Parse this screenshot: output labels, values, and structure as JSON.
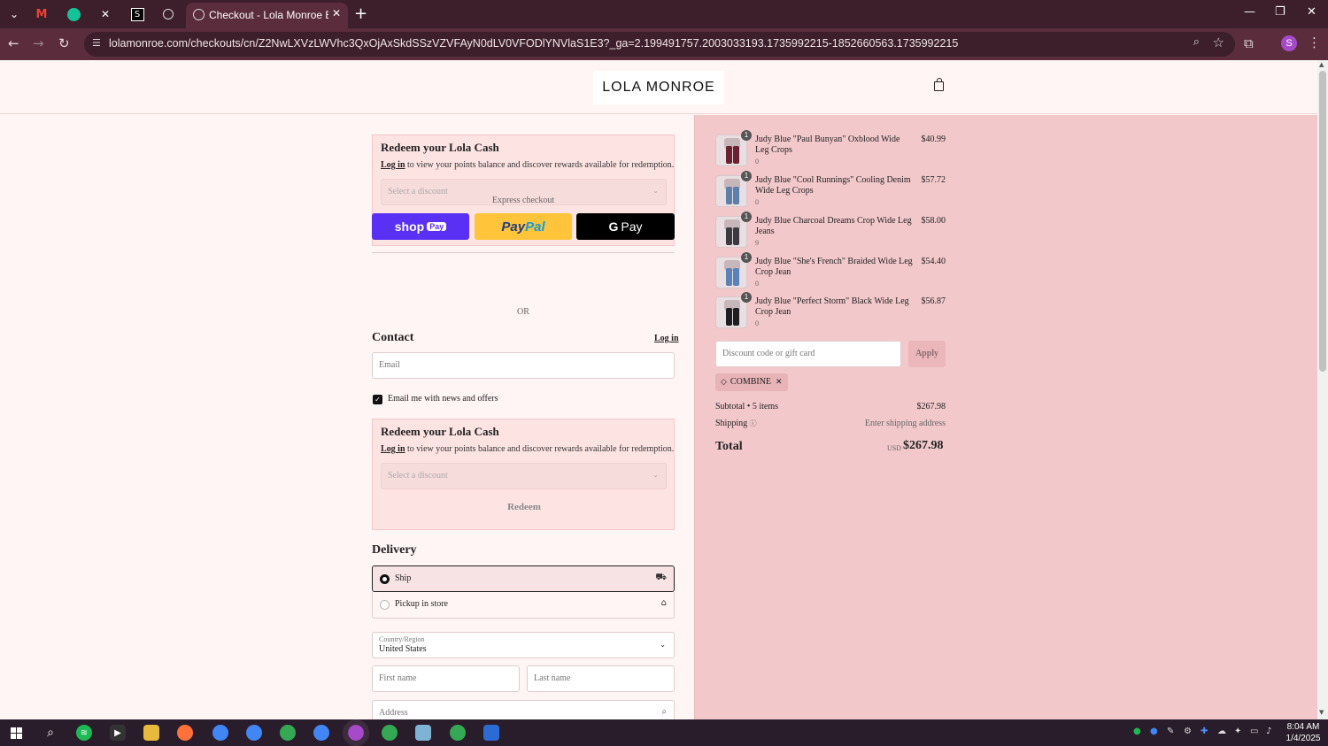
{
  "browser": {
    "tab_title": "Checkout - Lola Monroe Boutique",
    "url": "lolamonroe.com/checkouts/cn/Z2NwLXVzLWVhc3QxOjAxSkdSSzVZVFAyN0dLV0VFODlYNVlaS1E3?_ga=2.199491757.2003033193.1735992215-1852660563.1735992215",
    "profile_initial": "S"
  },
  "header": {
    "logo": "LOLA MONROE"
  },
  "lola_cash": {
    "title": "Redeem your Lola Cash",
    "login": "Log in",
    "desc": "to view your points balance and discover rewards available for redemption.",
    "select_placeholder": "Select a discount",
    "redeem": "Redeem"
  },
  "express": {
    "label": "Express checkout",
    "shop_pay": "shop",
    "shop_pay_badge": "Pay",
    "paypal_a": "Pay",
    "paypal_b": "Pal",
    "gpay_g": "G",
    "gpay": "Pay",
    "or": "OR"
  },
  "contact": {
    "heading": "Contact",
    "login": "Log in",
    "email_placeholder": "Email",
    "newsletter": "Email me with news and offers"
  },
  "delivery": {
    "heading": "Delivery",
    "ship": "Ship",
    "pickup": "Pickup in store",
    "country_label": "Country/Region",
    "country_value": "United States",
    "first_name": "First name",
    "last_name": "Last name",
    "address": "Address"
  },
  "order": {
    "items": [
      {
        "name": "Judy Blue \"Paul Bunyan\" Oxblood Wide Leg Crops",
        "sub": "0",
        "price": "$40.99",
        "qty": "1",
        "color": "#6a2232"
      },
      {
        "name": "Judy Blue \"Cool Runnings\" Cooling Denim Wide Leg Crops",
        "sub": "0",
        "price": "$57.72",
        "qty": "1",
        "color": "#5d7fa8"
      },
      {
        "name": "Judy Blue Charcoal Dreams Crop Wide Leg Jeans",
        "sub": "9",
        "price": "$58.00",
        "qty": "1",
        "color": "#3a3a40"
      },
      {
        "name": "Judy Blue \"She's French\" Braided Wide Leg Crop Jean",
        "sub": "0",
        "price": "$54.40",
        "qty": "1",
        "color": "#5b82b6"
      },
      {
        "name": "Judy Blue \"Perfect Storm\" Black Wide Leg Crop Jean",
        "sub": "0",
        "price": "$56.87",
        "qty": "1",
        "color": "#1e1e22"
      }
    ],
    "discount_placeholder": "Discount code or gift card",
    "apply": "Apply",
    "applied_code": "COMBINE",
    "subtotal_label": "Subtotal • 5 items",
    "subtotal": "$267.98",
    "shipping_label": "Shipping",
    "shipping_value": "Enter shipping address",
    "total_label": "Total",
    "currency": "USD",
    "total": "$267.98"
  },
  "taskbar": {
    "time": "8:04 AM",
    "date": "1/4/2025"
  },
  "colors": {
    "right_panel": "#f2c8cb",
    "page_bg": "#fff5f4",
    "shop_pay": "#5a31f4",
    "paypal": "#ffc439"
  }
}
